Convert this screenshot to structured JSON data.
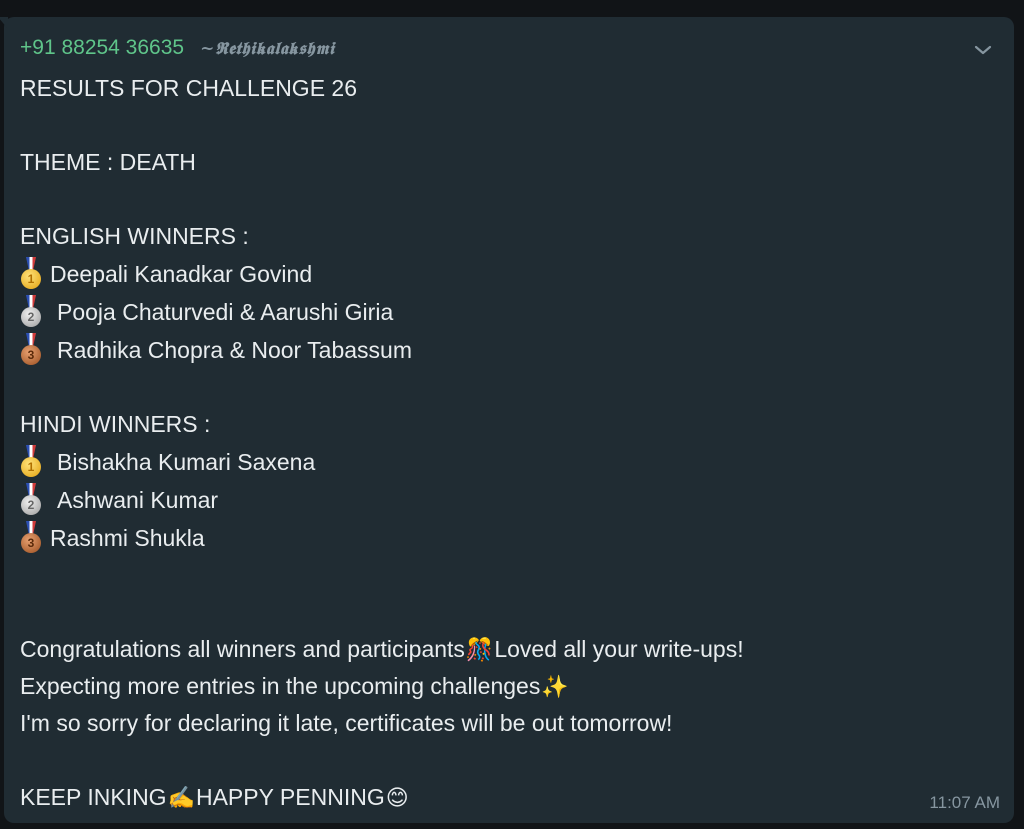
{
  "message": {
    "sender_phone": "+91 88254 36635",
    "sender_name": "~𝕽𝖊𝖙𝖍𝖎𝖐𝖆𝖑𝖆𝖐𝖘𝖍𝖒𝖎",
    "timestamp": "11:07 AM",
    "title_line": "RESULTS FOR CHALLENGE 26",
    "theme_line": "THEME : DEATH",
    "english_heading": "ENGLISH WINNERS :",
    "english_winners": [
      {
        "medal": "gold-medal-icon",
        "name": "Deepali Kanadkar Govind"
      },
      {
        "medal": "silver-medal-icon",
        "name": "Pooja Chaturvedi & Aarushi Giria"
      },
      {
        "medal": "bronze-medal-icon",
        "name": "Radhika Chopra & Noor Tabassum"
      }
    ],
    "hindi_heading": "HINDI WINNERS :",
    "hindi_winners": [
      {
        "medal": "gold-medal-icon",
        "name": "Bishakha Kumari Saxena"
      },
      {
        "medal": "silver-medal-icon",
        "name": "Ashwani Kumar"
      },
      {
        "medal": "bronze-medal-icon",
        "name": "Rashmi Shukla"
      }
    ],
    "congrats_part1": "Congratulations all winners and participants",
    "congrats_part2": "Loved all your write-ups!",
    "expecting_line": "Expecting more entries in the upcoming challenges",
    "sorry_line": "I'm so sorry for declaring it late, certificates will be out tomorrow!",
    "keep_inking": "KEEP INKING",
    "happy_penning": "HAPPY PENNING",
    "emoji": {
      "party_popper": "🎊",
      "sparkles": "✨",
      "writing_hand": "✍️",
      "smiling_face": "😊"
    }
  },
  "icons": {
    "menu": "chevron-down-icon"
  },
  "colors": {
    "bubble": "#202c33",
    "sender_phone": "#5fc58a",
    "text": "#e9edef",
    "meta": "#8696a0"
  }
}
